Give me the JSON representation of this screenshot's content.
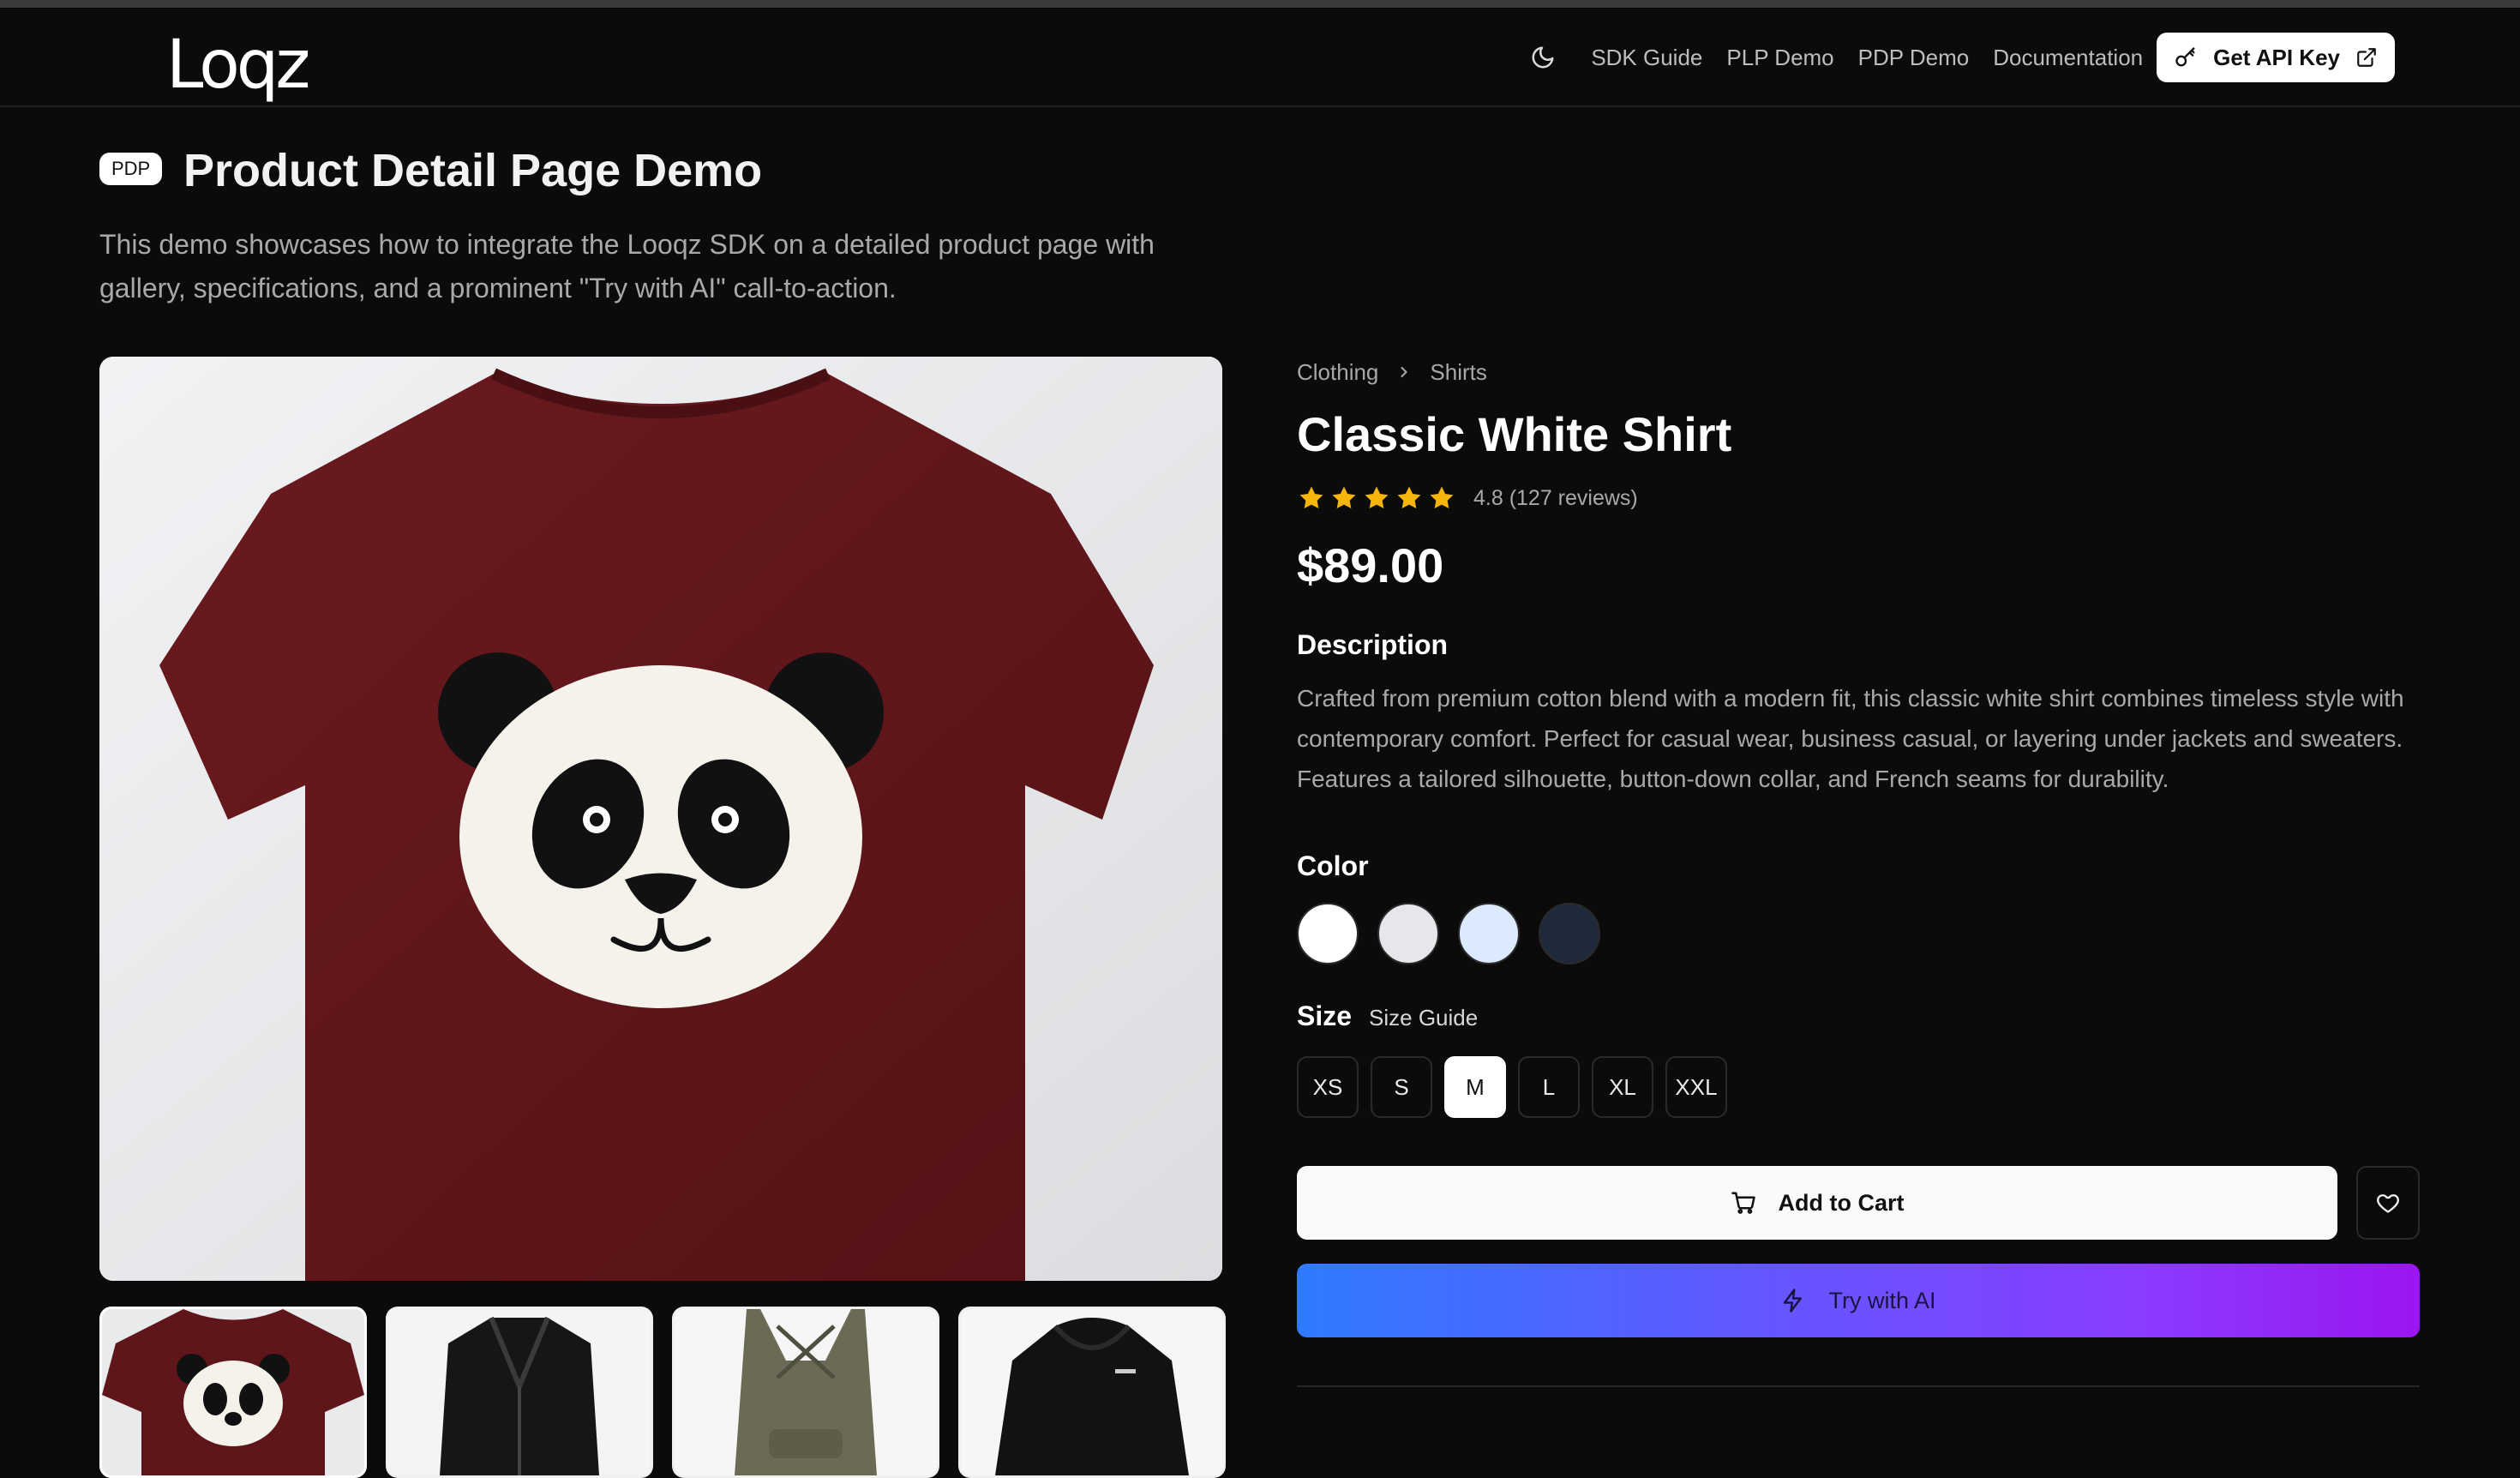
{
  "nav": {
    "logo": "Loqz",
    "links": [
      "SDK Guide",
      "PLP Demo",
      "PDP Demo",
      "Documentation"
    ],
    "api_button": "Get API Key"
  },
  "header": {
    "badge": "PDP",
    "title": "Product Detail Page Demo",
    "description": "This demo showcases how to integrate the Looqz SDK on a detailed product page with gallery, specifications, and a prominent \"Try with AI\" call-to-action."
  },
  "product": {
    "breadcrumb": [
      "Clothing",
      "Shirts"
    ],
    "title": "Classic White Shirt",
    "rating_stars": 5,
    "rating_text": "4.8 (127 reviews)",
    "price": "$89.00",
    "description_title": "Description",
    "description": "Crafted from premium cotton blend with a modern fit, this classic white shirt combines timeless style with contemporary comfort. Perfect for casual wear, business casual, or layering under jackets and sweaters. Features a tailored silhouette, button-down collar, and French seams for durability.",
    "color_title": "Color",
    "colors": [
      "#ffffff",
      "#e5e7eb",
      "#dbeafe",
      "#1e293b"
    ],
    "size_title": "Size",
    "size_guide": "Size Guide",
    "sizes": [
      "XS",
      "S",
      "M",
      "L",
      "XL",
      "XXL"
    ],
    "selected_size": "M",
    "add_to_cart": "Add to Cart",
    "try_ai": "Try with AI"
  },
  "gallery": {
    "thumbnail_names": [
      "maroon-panda-tshirt",
      "black-leather-jacket",
      "olive-tank-top",
      "black-hoodie"
    ]
  },
  "colors": {
    "star": "#f5b50a",
    "accent_gradient_start": "#2f7bff",
    "accent_gradient_end": "#9b15f0"
  }
}
